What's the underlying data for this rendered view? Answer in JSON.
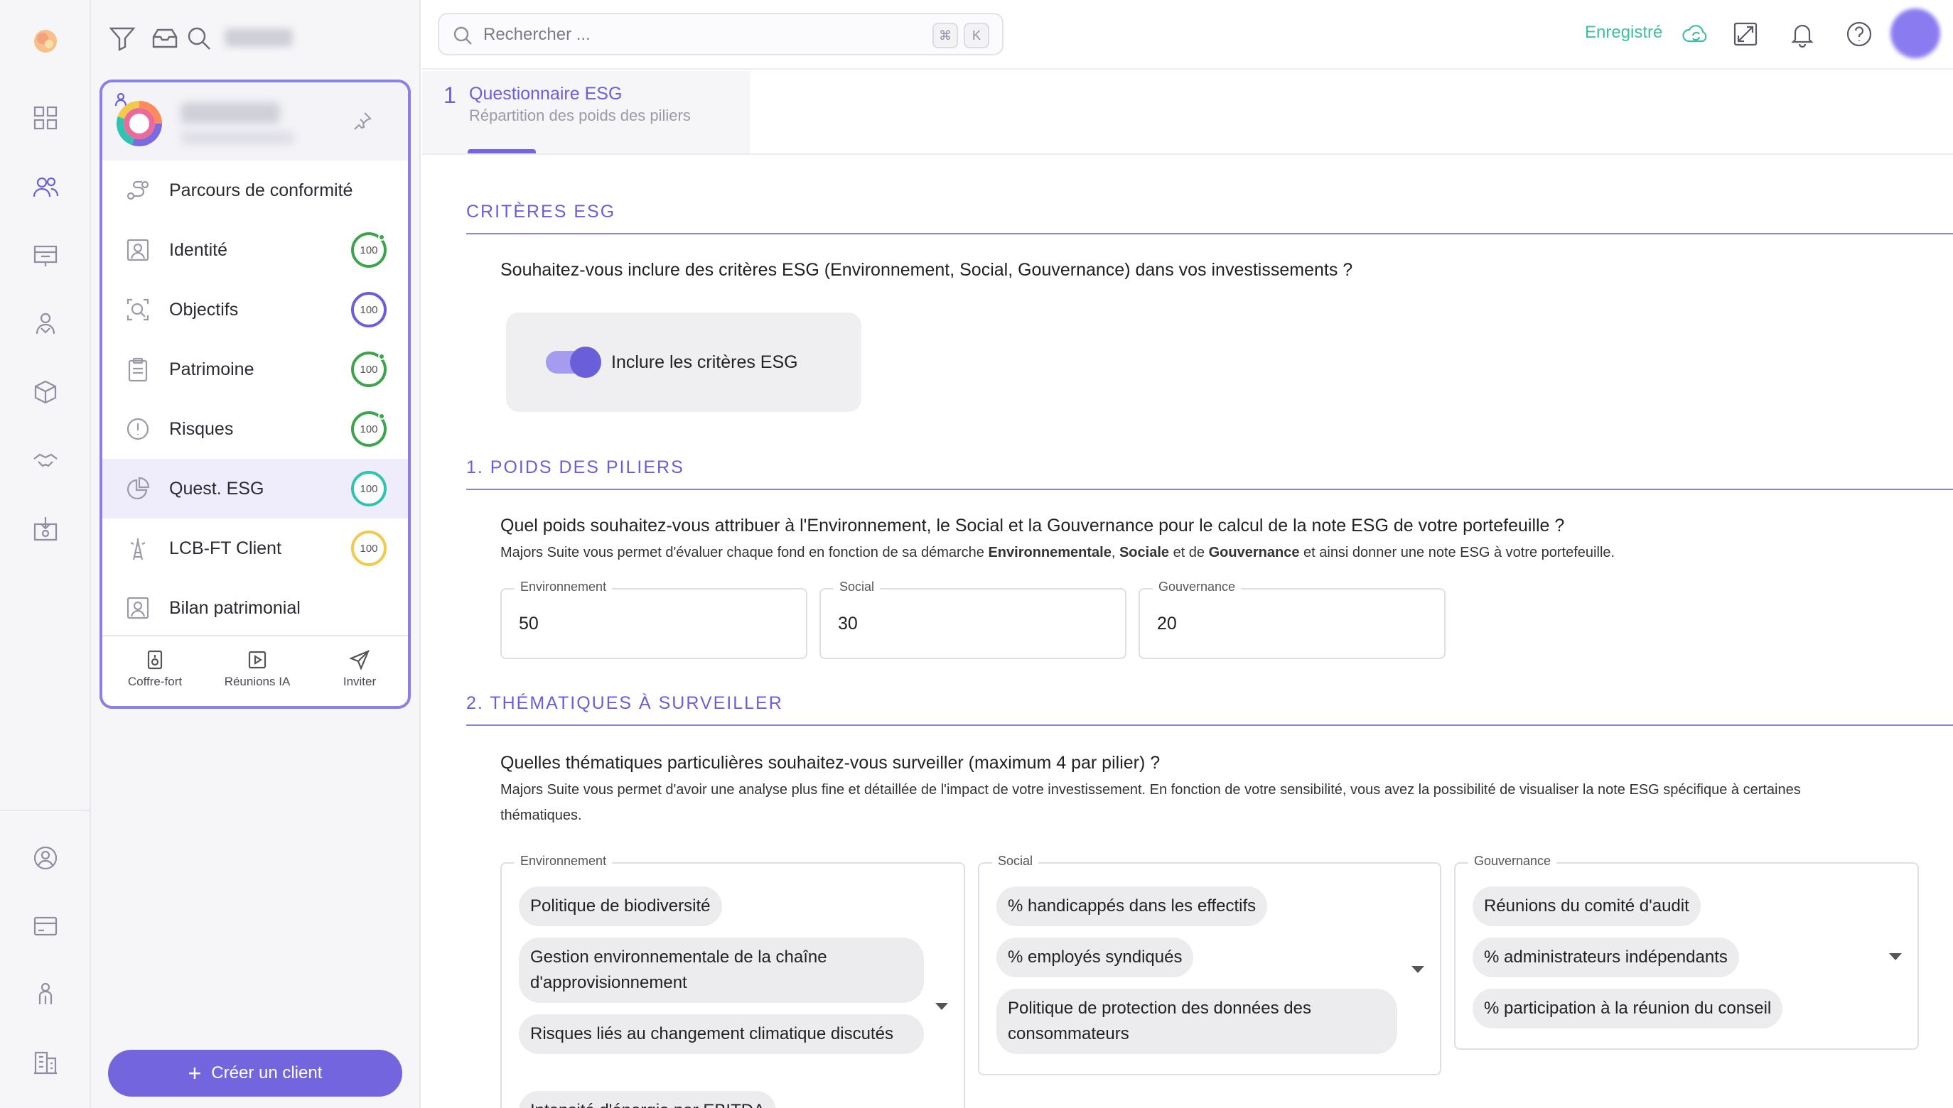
{
  "header": {
    "search_placeholder": "Rechercher ...",
    "kbd_cmd": "⌘",
    "kbd_k": "K",
    "saved_label": "Enregistré"
  },
  "sidebar": {
    "items": [
      {
        "label": "Parcours de conformité",
        "icon": "route-icon"
      },
      {
        "label": "Identité",
        "icon": "id-card-icon",
        "score": "100",
        "ring": "#3aa54a",
        "dot": true
      },
      {
        "label": "Objectifs",
        "icon": "target-icon",
        "score": "100",
        "ring": "#6a5fd8",
        "dot": false
      },
      {
        "label": "Patrimoine",
        "icon": "clipboard-icon",
        "score": "100",
        "ring": "#3aa54a",
        "dot": true
      },
      {
        "label": "Risques",
        "icon": "alert-icon",
        "score": "100",
        "ring": "#3aa54a",
        "dot": true
      },
      {
        "label": "Quest. ESG",
        "icon": "pie-chart-icon",
        "score": "100",
        "ring": "#2fc4b2",
        "dot": false
      },
      {
        "label": "LCB-FT Client",
        "icon": "tower-icon",
        "score": "100",
        "ring": "#f2c94c",
        "dot": false
      },
      {
        "label": "Bilan patrimonial",
        "icon": "portrait-icon"
      }
    ],
    "footer": [
      {
        "label": "Coffre-fort",
        "icon": "vault-icon"
      },
      {
        "label": "Réunions IA",
        "icon": "play-icon"
      },
      {
        "label": "Inviter",
        "icon": "send-icon"
      }
    ],
    "create_label": "Créer un client"
  },
  "step": {
    "number": "1",
    "title": "Questionnaire ESG",
    "subtitle": "Répartition des poids des piliers"
  },
  "criteria": {
    "title": "CRITÈRES ESG",
    "question": "Souhaitez-vous inclure des critères ESG (Environnement, Social, Gouvernance) dans vos investissements ?",
    "toggle_label": "Inclure les critères ESG",
    "toggle_on": true
  },
  "weights": {
    "title": "1. POIDS DES PILIERS",
    "question": "Quel poids souhaitez-vous attribuer à l'Environnement, le Social et la Gouvernance pour le calcul de la note ESG de votre portefeuille ?",
    "hint_a": "Majors Suite vous permet d'évaluer chaque fond en fonction de sa démarche ",
    "hint_b": "Environnementale",
    "hint_c": ", ",
    "hint_d": "Sociale",
    "hint_e": " et de ",
    "hint_f": "Gouvernance",
    "hint_g": " et ainsi donner une note ESG à votre portefeuille.",
    "fields": [
      {
        "label": "Environnement",
        "value": "50"
      },
      {
        "label": "Social",
        "value": "30"
      },
      {
        "label": "Gouvernance",
        "value": "20"
      }
    ]
  },
  "themes": {
    "title": "2. THÉMATIQUES À SURVEILLER",
    "question": "Quelles thématiques particulières souhaitez-vous surveiller (maximum 4 par pilier) ?",
    "hint": "Majors Suite vous permet d'avoir une analyse plus fine et détaillée de l'impact de votre investissement. En fonction de votre sensibilité, vous avez la possibilité de visualiser la note ESG spécifique à certaines thématiques.",
    "environment": {
      "label": "Environnement",
      "chips": [
        "Politique de biodiversité",
        "Gestion environnementale de la chaîne d'approvisionnement",
        "Risques liés au changement climatique discutés",
        "Intensité d'énergie par EBITDA"
      ]
    },
    "social": {
      "label": "Social",
      "chips": [
        "% handicappés dans les effectifs",
        "% employés syndiqués",
        "Politique de protection des données des consommateurs"
      ]
    },
    "governance": {
      "label": "Gouvernance",
      "chips": [
        "Réunions du comité d'audit",
        "% administrateurs indépendants",
        "% participation à la réunion du conseil"
      ]
    }
  }
}
